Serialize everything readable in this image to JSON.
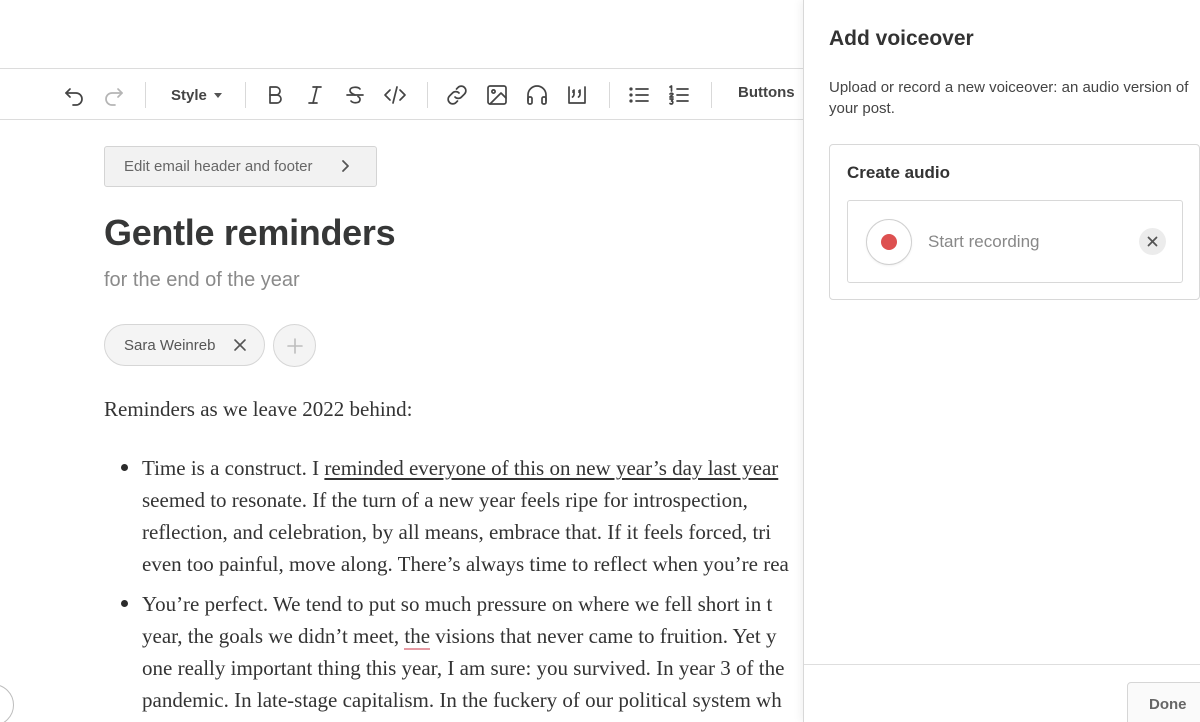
{
  "toolbar": {
    "style_label": "Style",
    "buttons_label": "Buttons",
    "icons": [
      "undo-icon",
      "redo-icon",
      "bold-icon",
      "italic-icon",
      "strikethrough-icon",
      "code-icon",
      "link-icon",
      "image-icon",
      "audio-icon",
      "quote-icon",
      "bulleted-list-icon",
      "numbered-list-icon"
    ]
  },
  "editor": {
    "email_header_button": "Edit email header and footer",
    "title": "Gentle reminders",
    "subtitle": "for the end of the year",
    "author": "Sara Weinreb",
    "intro": "Reminders as we leave 2022 behind:",
    "bullets": [
      {
        "lines": [
          {
            "pre": "Time is a construct. I ",
            "link": "reminded everyone of this on new year’s day last year",
            "post": ""
          },
          {
            "text": "seemed to resonate. If the turn of a new year feels ripe for introspection,"
          },
          {
            "text": "reflection, and celebration, by all means, embrace that. If it feels forced, tri"
          },
          {
            "text": "even too painful, move along. There’s always time to reflect when you’re rea"
          }
        ]
      },
      {
        "lines": [
          {
            "text": "You’re perfect. We tend to put so much pressure on where we fell short in t"
          },
          {
            "pre": "year, the goals we didn’t meet, ",
            "spell": "the",
            "post": " visions that never came to fruition. Yet y"
          },
          {
            "text": "one really important thing this year, I am sure: you survived. In year 3 of the"
          },
          {
            "text": "pandemic. In late-stage capitalism. In the fuckery of our political system wh"
          }
        ]
      }
    ]
  },
  "panel": {
    "title": "Add voiceover",
    "description": "Upload or record a new voiceover: an audio version of your post.",
    "card_title": "Create audio",
    "record_label": "Start recording",
    "done_label": "Done",
    "record_color": "#dd5050"
  }
}
